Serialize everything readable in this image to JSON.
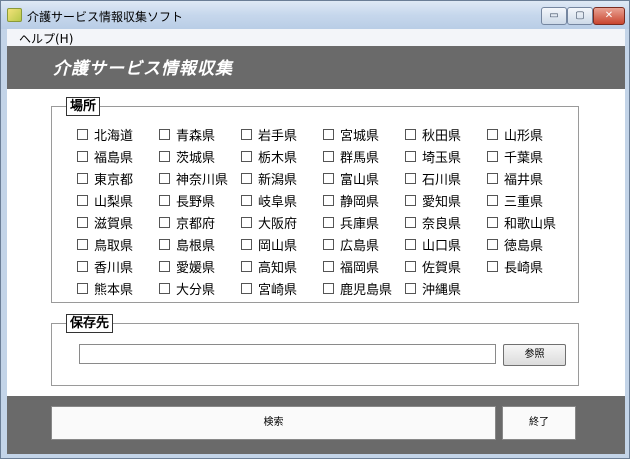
{
  "window": {
    "title": "介護サービス情報収集ソフト",
    "minimize": "▭",
    "maximize": "▢",
    "close": "✕"
  },
  "menu": {
    "help": "ヘルプ(H)"
  },
  "header": {
    "title": "介護サービス情報収集"
  },
  "location": {
    "label": "場所",
    "prefectures": [
      "北海道",
      "青森県",
      "岩手県",
      "宮城県",
      "秋田県",
      "山形県",
      "福島県",
      "茨城県",
      "栃木県",
      "群馬県",
      "埼玉県",
      "千葉県",
      "東京都",
      "神奈川県",
      "新潟県",
      "富山県",
      "石川県",
      "福井県",
      "山梨県",
      "長野県",
      "岐阜県",
      "静岡県",
      "愛知県",
      "三重県",
      "滋賀県",
      "京都府",
      "大阪府",
      "兵庫県",
      "奈良県",
      "和歌山県",
      "鳥取県",
      "島根県",
      "岡山県",
      "広島県",
      "山口県",
      "徳島県",
      "香川県",
      "愛媛県",
      "高知県",
      "福岡県",
      "佐賀県",
      "長崎県",
      "熊本県",
      "大分県",
      "宮崎県",
      "鹿児島県",
      "沖縄県"
    ]
  },
  "save": {
    "label": "保存先",
    "path_value": "",
    "browse": "参照"
  },
  "footer": {
    "search": "検索",
    "exit": "終了"
  }
}
